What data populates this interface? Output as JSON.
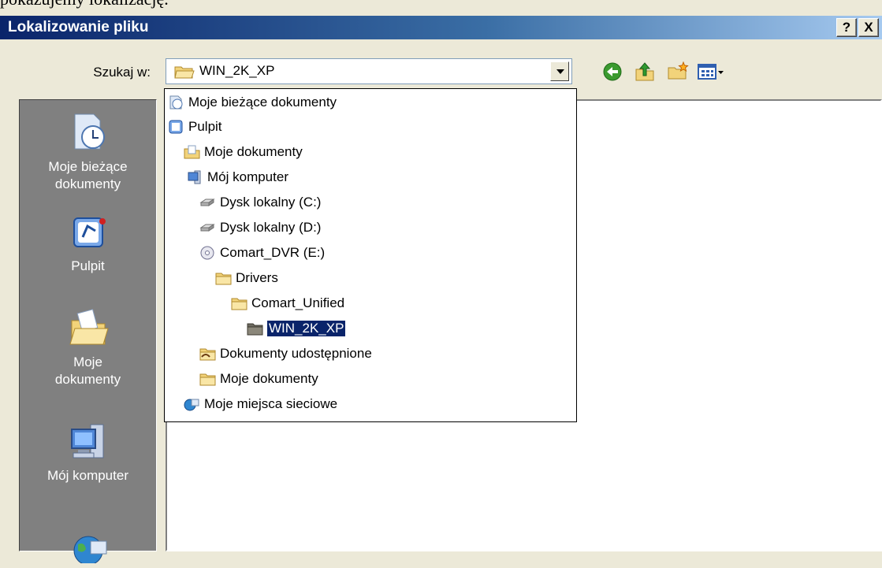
{
  "caption": "pokazujemy lokalizację.",
  "window": {
    "title": "Lokalizowanie pliku",
    "help_label": "?",
    "close_label": "X"
  },
  "lookin": {
    "label": "Szukaj w:",
    "value": "WIN_2K_XP"
  },
  "toolbar": {
    "icons": [
      "back-icon",
      "up-folder-icon",
      "new-folder-icon",
      "view-menu-icon"
    ]
  },
  "places": [
    {
      "label": "Moje bieżące dokumenty",
      "icon": "recent-documents-icon"
    },
    {
      "label": "Pulpit",
      "icon": "desktop-icon"
    },
    {
      "label": "Moje dokumenty",
      "icon": "my-documents-icon"
    },
    {
      "label": "Mój komputer",
      "icon": "my-computer-icon"
    },
    {
      "label": "",
      "icon": "network-places-icon"
    }
  ],
  "dropdown": {
    "items": [
      {
        "label": "Moje bieżące dokumenty",
        "icon": "recent-documents-icon"
      },
      {
        "label": "Pulpit",
        "icon": "desktop-icon"
      },
      {
        "label": "Moje dokumenty",
        "icon": "my-documents-icon"
      },
      {
        "label": "Mój komputer",
        "icon": "my-computer-icon"
      },
      {
        "label": "Dysk lokalny (C:)",
        "icon": "hard-drive-icon"
      },
      {
        "label": "Dysk lokalny (D:)",
        "icon": "hard-drive-icon"
      },
      {
        "label": "Comart_DVR (E:)",
        "icon": "cd-drive-icon"
      },
      {
        "label": "Drivers",
        "icon": "folder-icon"
      },
      {
        "label": "Comart_Unified",
        "icon": "folder-icon"
      },
      {
        "label": "WIN_2K_XP",
        "icon": "open-folder-icon",
        "selected": true
      },
      {
        "label": "Dokumenty udostępnione",
        "icon": "shared-folder-icon"
      },
      {
        "label": "Moje dokumenty",
        "icon": "folder-icon"
      },
      {
        "label": "Moje miejsca sieciowe",
        "icon": "network-places-icon"
      }
    ]
  },
  "colors": {
    "titlebar_start": "#0a246a",
    "titlebar_end": "#a6caf0",
    "selection": "#0a246a",
    "places_bg": "#808080",
    "dialog_bg": "#ece9d8"
  }
}
